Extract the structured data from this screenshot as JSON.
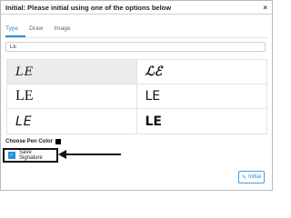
{
  "dialog": {
    "title": "Initial: Please initial using one of the options below",
    "close_icon": "×"
  },
  "tabs": [
    {
      "label": "Type",
      "active": true
    },
    {
      "label": "Draw",
      "active": false
    },
    {
      "label": "Image",
      "active": false
    }
  ],
  "input": {
    "value": "LE"
  },
  "options": [
    {
      "text": "LE",
      "selected": true
    },
    {
      "text": "ℒℰ",
      "selected": false
    },
    {
      "text": "LE",
      "selected": false
    },
    {
      "text": "LE",
      "selected": false
    },
    {
      "text": "LE",
      "selected": false
    },
    {
      "text": "LE",
      "selected": false
    }
  ],
  "pen_color": {
    "label": "Choose Pen Color",
    "color": "#000000"
  },
  "save_signature": {
    "label": "Save Signature",
    "checked": true,
    "check_glyph": "✓"
  },
  "footer": {
    "initial_button_label": "Initial",
    "pen_icon": "✎"
  },
  "colors": {
    "accent": "#2a8fd6",
    "highlight_border": "#111111"
  }
}
